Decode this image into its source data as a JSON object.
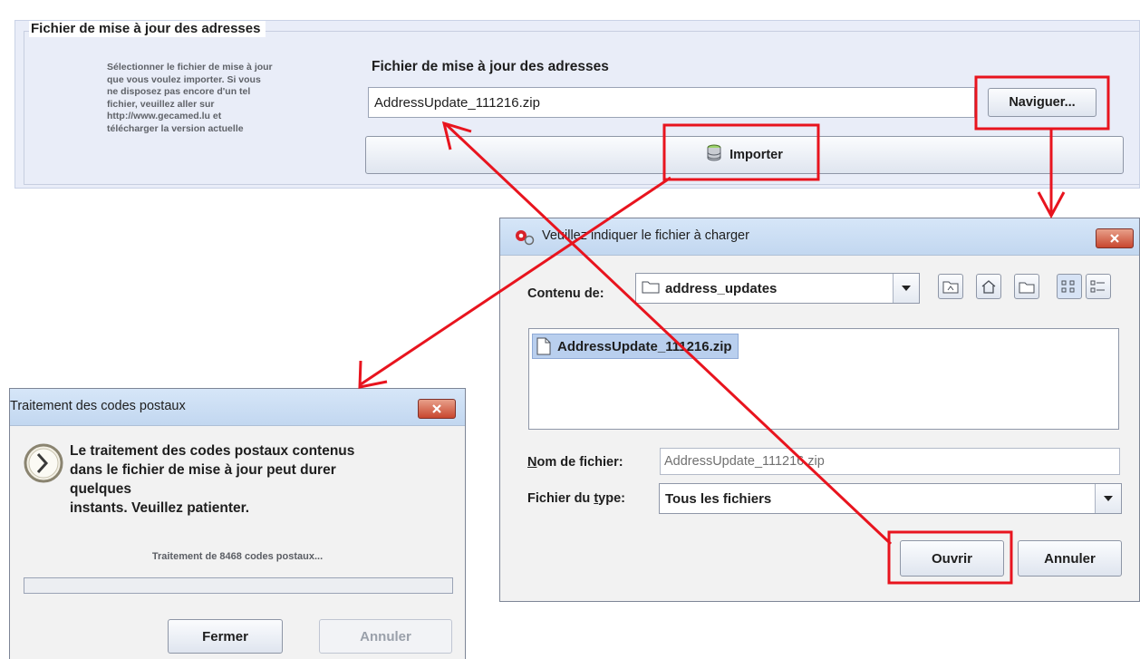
{
  "import_panel": {
    "group_title": "Fichier de mise à jour des adresses",
    "description": [
      "Sélectionner le fichier de mise à jour",
      "que vous voulez importer. Si vous",
      "ne disposez pas encore d'un tel",
      "fichier, veuillez aller sur",
      "http://www.gecamed.lu et",
      "télécharger la version actuelle"
    ],
    "field_label": "Fichier de mise à jour des adresses",
    "file_path": "AddressUpdate_111216.zip",
    "browse_label": "Naviguer...",
    "import_label": "Importer"
  },
  "file_chooser": {
    "title": "Veuillez indiquer le fichier à charger",
    "look_in_label": "Contenu de:",
    "look_in_value": "address_updates",
    "files": [
      "AddressUpdate_111216.zip"
    ],
    "filename_label_first": "N",
    "filename_label_rest": "om de fichier:",
    "filename_value": "AddressUpdate_111216.zip",
    "filetype_label_first": "Fichier du ",
    "filetype_label_mnemonic": "t",
    "filetype_label_rest": "ype:",
    "filetype_value": "Tous les fichiers",
    "open_label": "Ouvrir",
    "cancel_label": "Annuler"
  },
  "processing_dialog": {
    "title": "Traitement des codes postaux",
    "message": [
      "Le traitement des codes postaux contenus",
      "dans le fichier de mise à jour peut durer",
      "quelques",
      "instants. Veuillez patienter."
    ],
    "status": "Traitement de 8468 codes postaux...",
    "progress": 0,
    "close_label": "Fermer",
    "cancel_label": "Annuler"
  },
  "colors": {
    "annotation": "#e8141e",
    "titlebar": "#c8daf2",
    "close_button": "#d0533b",
    "selection": "#b9cfee"
  },
  "icons": [
    "database-icon",
    "app-icon",
    "folder-icon",
    "up-folder-icon",
    "home-icon",
    "new-folder-icon",
    "list-view-icon",
    "details-view-icon",
    "file-icon",
    "clock-icon",
    "close-icon",
    "chevron-down-icon"
  ]
}
